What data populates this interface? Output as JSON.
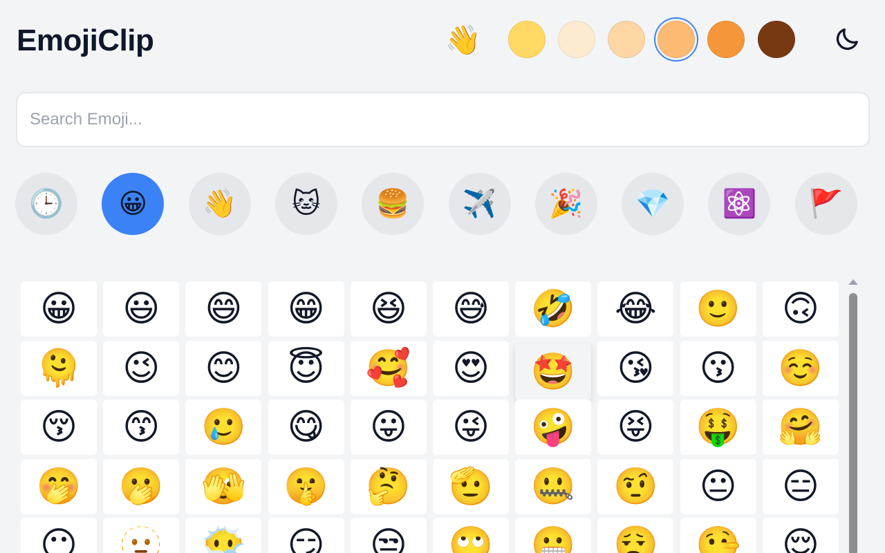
{
  "app": {
    "title": "EmojiClip",
    "preview_emoji": "👋",
    "skin_tones": [
      {
        "name": "default",
        "color": "#FFD964"
      },
      {
        "name": "light",
        "color": "#FDEBD0"
      },
      {
        "name": "medium-light",
        "color": "#FDD6A4"
      },
      {
        "name": "medium",
        "color": "#FCBA73",
        "selected": true
      },
      {
        "name": "medium-dark",
        "color": "#F6963A"
      },
      {
        "name": "dark",
        "color": "#773911"
      }
    ],
    "theme_icon": "moon-icon"
  },
  "search": {
    "placeholder": "Search Emoji...",
    "value": ""
  },
  "categories": [
    {
      "id": "recent",
      "icon": "🕒",
      "active": false
    },
    {
      "id": "smileys",
      "icon": "😀",
      "active": true
    },
    {
      "id": "people",
      "icon": "👋",
      "active": false
    },
    {
      "id": "animals",
      "icon": "🐱",
      "active": false
    },
    {
      "id": "food",
      "icon": "🍔",
      "active": false
    },
    {
      "id": "travel",
      "icon": "✈️",
      "active": false
    },
    {
      "id": "activities",
      "icon": "🎉",
      "active": false
    },
    {
      "id": "objects",
      "icon": "💎",
      "active": false
    },
    {
      "id": "symbols",
      "icon": "⚛️",
      "active": false
    },
    {
      "id": "flags",
      "icon": "🚩",
      "active": false
    }
  ],
  "emojis": [
    [
      "😀",
      "😃",
      "😄",
      "😁",
      "😆",
      "😅",
      "🤣",
      "😂",
      "🙂",
      "🙃"
    ],
    [
      "🫠",
      "😉",
      "😊",
      "😇",
      "🥰",
      "😍",
      "🤩",
      "😘",
      "😗",
      "☺️"
    ],
    [
      "😚",
      "😙",
      "🥲",
      "😋",
      "😛",
      "😜",
      "🤪",
      "😝",
      "🤑",
      "🤗"
    ],
    [
      "🤭",
      "🫢",
      "🫣",
      "🤫",
      "🤔",
      "🫡",
      "🤐",
      "🤨",
      "😐",
      "😑"
    ],
    [
      "😶",
      "🫥",
      "😶‍🌫️",
      "😏",
      "😒",
      "🙄",
      "😬",
      "😮‍💨",
      "🤥",
      "😌"
    ]
  ],
  "hovered_cell": {
    "row": 1,
    "col": 6
  }
}
